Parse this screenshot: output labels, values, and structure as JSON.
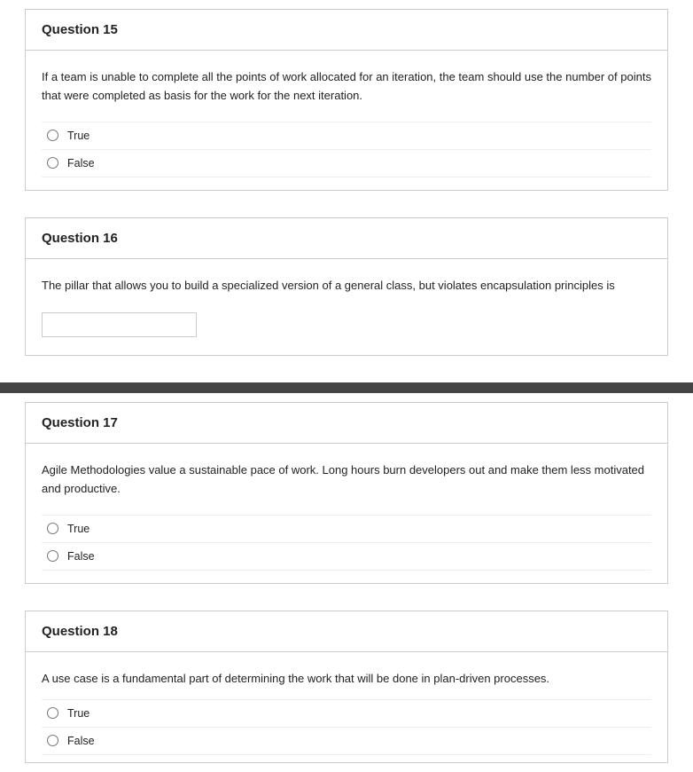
{
  "questions": [
    {
      "title": "Question 15",
      "text": "If a team is unable to complete all the points of work allocated for an iteration, the team should use the number of points that were completed as basis for the work for the next iteration.",
      "type": "truefalse",
      "options": {
        "true": "True",
        "false": "False"
      }
    },
    {
      "title": "Question 16",
      "text": "The pillar that allows you to build a specialized version of a general class, but violates encapsulation principles is",
      "type": "text",
      "value": ""
    },
    {
      "title": "Question 17",
      "text": "Agile Methodologies value a sustainable pace of work. Long hours burn developers out and make them less motivated and productive.",
      "type": "truefalse",
      "options": {
        "true": "True",
        "false": "False"
      }
    },
    {
      "title": "Question 18",
      "text": "A use case is a fundamental part of determining the work that will be done in plan-driven processes.",
      "type": "truefalse",
      "options": {
        "true": "True",
        "false": "False"
      }
    }
  ]
}
